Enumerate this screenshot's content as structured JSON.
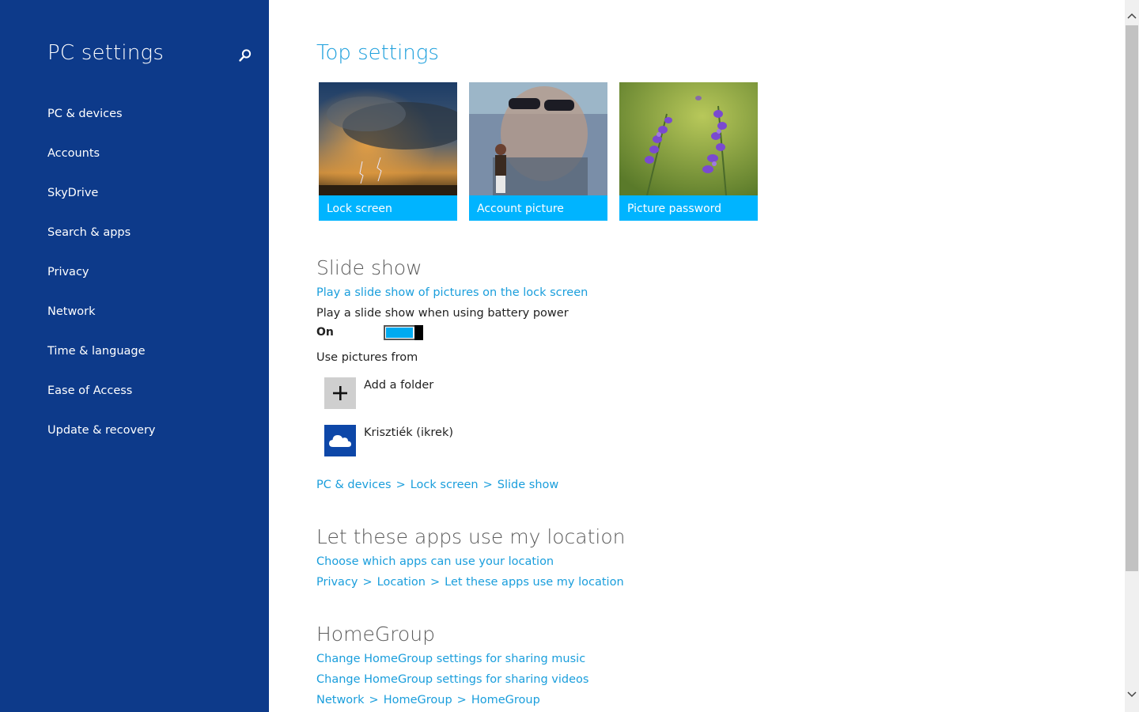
{
  "sidebar": {
    "title": "PC settings",
    "items": [
      {
        "label": "PC & devices"
      },
      {
        "label": "Accounts"
      },
      {
        "label": "SkyDrive"
      },
      {
        "label": "Search & apps"
      },
      {
        "label": "Privacy"
      },
      {
        "label": "Network"
      },
      {
        "label": "Time & language"
      },
      {
        "label": "Ease of Access"
      },
      {
        "label": "Update & recovery"
      }
    ]
  },
  "main": {
    "title": "Top settings",
    "tiles": [
      {
        "label": "Lock screen"
      },
      {
        "label": "Account picture"
      },
      {
        "label": "Picture password"
      }
    ],
    "slideshow": {
      "heading": "Slide show",
      "link": "Play a slide show of pictures on the lock screen",
      "battery_label": "Play a slide show when using battery power",
      "toggle_state": "On",
      "use_pictures_label": "Use pictures from",
      "folders": [
        {
          "label": "Add a folder",
          "icon": "plus-icon"
        },
        {
          "label": "Krisztiék (ikrek)",
          "icon": "cloud-icon"
        }
      ],
      "breadcrumb": [
        "PC & devices",
        "Lock screen",
        "Slide show"
      ]
    },
    "location": {
      "heading": "Let these apps use my location",
      "link": "Choose which apps can use your location",
      "breadcrumb": [
        "Privacy",
        "Location",
        "Let these apps use my location"
      ]
    },
    "homegroup": {
      "heading": "HomeGroup",
      "links": [
        "Change HomeGroup settings for sharing music",
        "Change HomeGroup settings for sharing videos"
      ],
      "breadcrumb": [
        "Network",
        "HomeGroup",
        "HomeGroup"
      ]
    },
    "breadcrumb_separator": ">"
  },
  "colors": {
    "sidebar_bg": "#0d3a8a",
    "accent": "#1a9edc",
    "tile_caption": "#00b4ff"
  }
}
